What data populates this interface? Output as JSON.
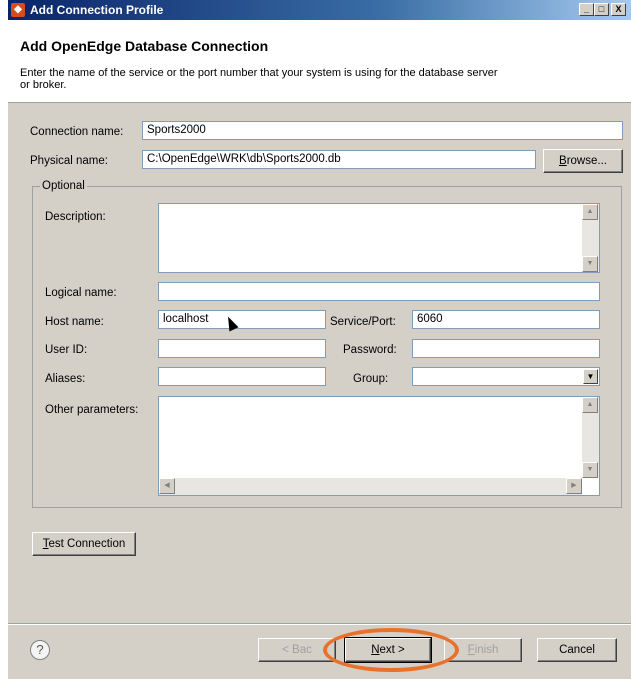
{
  "window": {
    "title": "Add Connection Profile",
    "minimize_glyph": "_",
    "maximize_glyph": "□",
    "close_glyph": "X"
  },
  "header": {
    "title": "Add OpenEdge Database Connection",
    "description": "Enter the name of the service or the port number that your system is using for the database server or broker."
  },
  "form": {
    "connection_name_label": "Connection name:",
    "connection_name_value": "Sports2000",
    "physical_name_label": "Physical name:",
    "physical_name_value": "C:\\OpenEdge\\WRK\\db\\Sports2000.db",
    "browse_label_rest": "rowse...",
    "browse_mnemonic": "B",
    "optional_group_label": "Optional",
    "description_label": "Description:",
    "description_value": "",
    "logical_name_label": "Logical name:",
    "logical_name_value": "",
    "host_name_label": "Host name:",
    "host_name_value": "localhost",
    "service_port_label": "Service/Port:",
    "service_port_value": "6060",
    "user_id_label": "User ID:",
    "user_id_value": "",
    "password_label": "Password:",
    "password_value": "",
    "aliases_label": "Aliases:",
    "aliases_value": "",
    "group_label": "Group:",
    "group_value": "",
    "other_parameters_label": "Other parameters:",
    "other_parameters_value": "",
    "test_connection_mnemonic": "T",
    "test_connection_rest": "est Connection"
  },
  "footer": {
    "help_glyph": "?",
    "back_label": "< Bac",
    "next_mnemonic": "N",
    "next_rest": "ext >",
    "finish_mnemonic": "F",
    "finish_rest": "inish",
    "cancel_label": "Cancel"
  },
  "colors": {
    "highlight_ring": "#e8722b",
    "title_bar": "#0a246a"
  }
}
